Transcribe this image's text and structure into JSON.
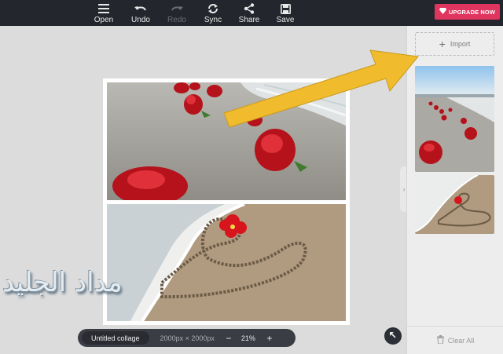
{
  "toolbar": {
    "open_label": "Open",
    "undo_label": "Undo",
    "redo_label": "Redo",
    "sync_label": "Sync",
    "share_label": "Share",
    "save_label": "Save",
    "upgrade_label": "UPGRADE NOW"
  },
  "sidebar": {
    "import_label": "Import",
    "clear_label": "Clear All"
  },
  "status": {
    "collage_name": "Untitled collage",
    "dimensions": "2000px × 2000px",
    "zoom_out": "−",
    "zoom_value": "21%",
    "zoom_in": "+"
  },
  "watermark": "مداد الجليد",
  "colors": {
    "toolbar_bg": "#23262c",
    "upgrade_bg": "#e0355e",
    "arrow": "#f0bb2c"
  }
}
